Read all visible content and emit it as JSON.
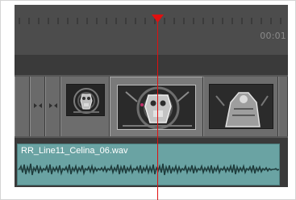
{
  "timeline": {
    "timecode": "00:01",
    "audio_clip": {
      "name": "RR_Line11_Celina_06.wav"
    }
  },
  "colors": {
    "playhead": "#e01010",
    "audio_clip": "#6aa3a3",
    "ruler_bg": "#4c4c4c"
  }
}
